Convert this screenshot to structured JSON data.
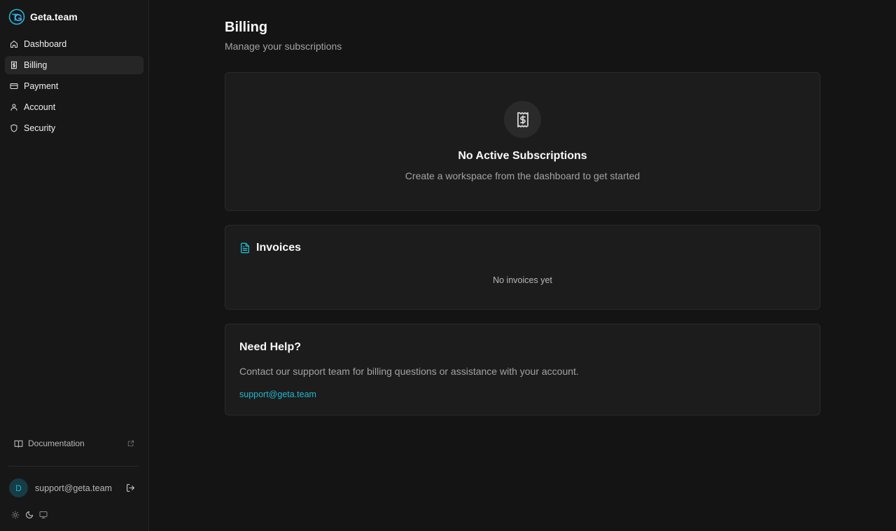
{
  "brand": {
    "name": "Geta.team",
    "logo_icon": "geta-logo-icon",
    "accent": "#22b8cf"
  },
  "sidebar": {
    "items": [
      {
        "label": "Dashboard",
        "icon": "home-icon",
        "active": false
      },
      {
        "label": "Billing",
        "icon": "receipt-icon",
        "active": true
      },
      {
        "label": "Payment",
        "icon": "credit-card-icon",
        "active": false
      },
      {
        "label": "Account",
        "icon": "user-icon",
        "active": false
      },
      {
        "label": "Security",
        "icon": "shield-icon",
        "active": false
      }
    ],
    "documentation": {
      "label": "Documentation",
      "icon": "book-icon",
      "external_icon": "external-link-icon"
    },
    "user": {
      "avatar_initial": "D",
      "email": "support@geta.team"
    },
    "theme_icons": [
      "sun-icon",
      "moon-icon",
      "monitor-icon"
    ]
  },
  "page": {
    "title": "Billing",
    "subtitle": "Manage your subscriptions"
  },
  "subscriptions": {
    "icon": "receipt-icon",
    "title": "No Active Subscriptions",
    "description": "Create a workspace from the dashboard to get started"
  },
  "invoices": {
    "icon": "file-text-icon",
    "title": "Invoices",
    "empty_text": "No invoices yet"
  },
  "help": {
    "title": "Need Help?",
    "description": "Contact our support team for billing questions or assistance with your account.",
    "email": "support@geta.team"
  }
}
